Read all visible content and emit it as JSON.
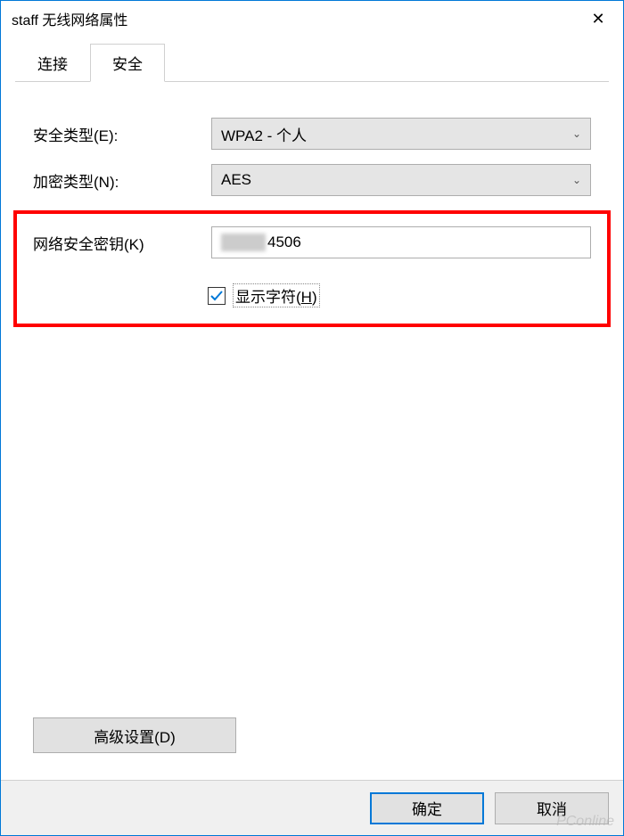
{
  "window": {
    "title": "staff 无线网络属性",
    "close_glyph": "✕"
  },
  "tabs": {
    "connect": "连接",
    "security": "安全"
  },
  "form": {
    "security_type_label": "安全类型(E):",
    "security_type_value": "WPA2 - 个人",
    "encryption_label": "加密类型(N):",
    "encryption_value": "AES",
    "key_label": "网络安全密钥(K)",
    "key_value_visible": "4506",
    "show_chars_prefix": "显示字符(",
    "show_chars_hotkey": "H",
    "show_chars_suffix": ")",
    "show_chars_checked": true
  },
  "buttons": {
    "advanced": "高级设置(D)",
    "ok": "确定",
    "cancel": "取消"
  },
  "watermark": "PConline",
  "colors": {
    "accent": "#0078d7",
    "highlight_border": "#ff0000"
  }
}
